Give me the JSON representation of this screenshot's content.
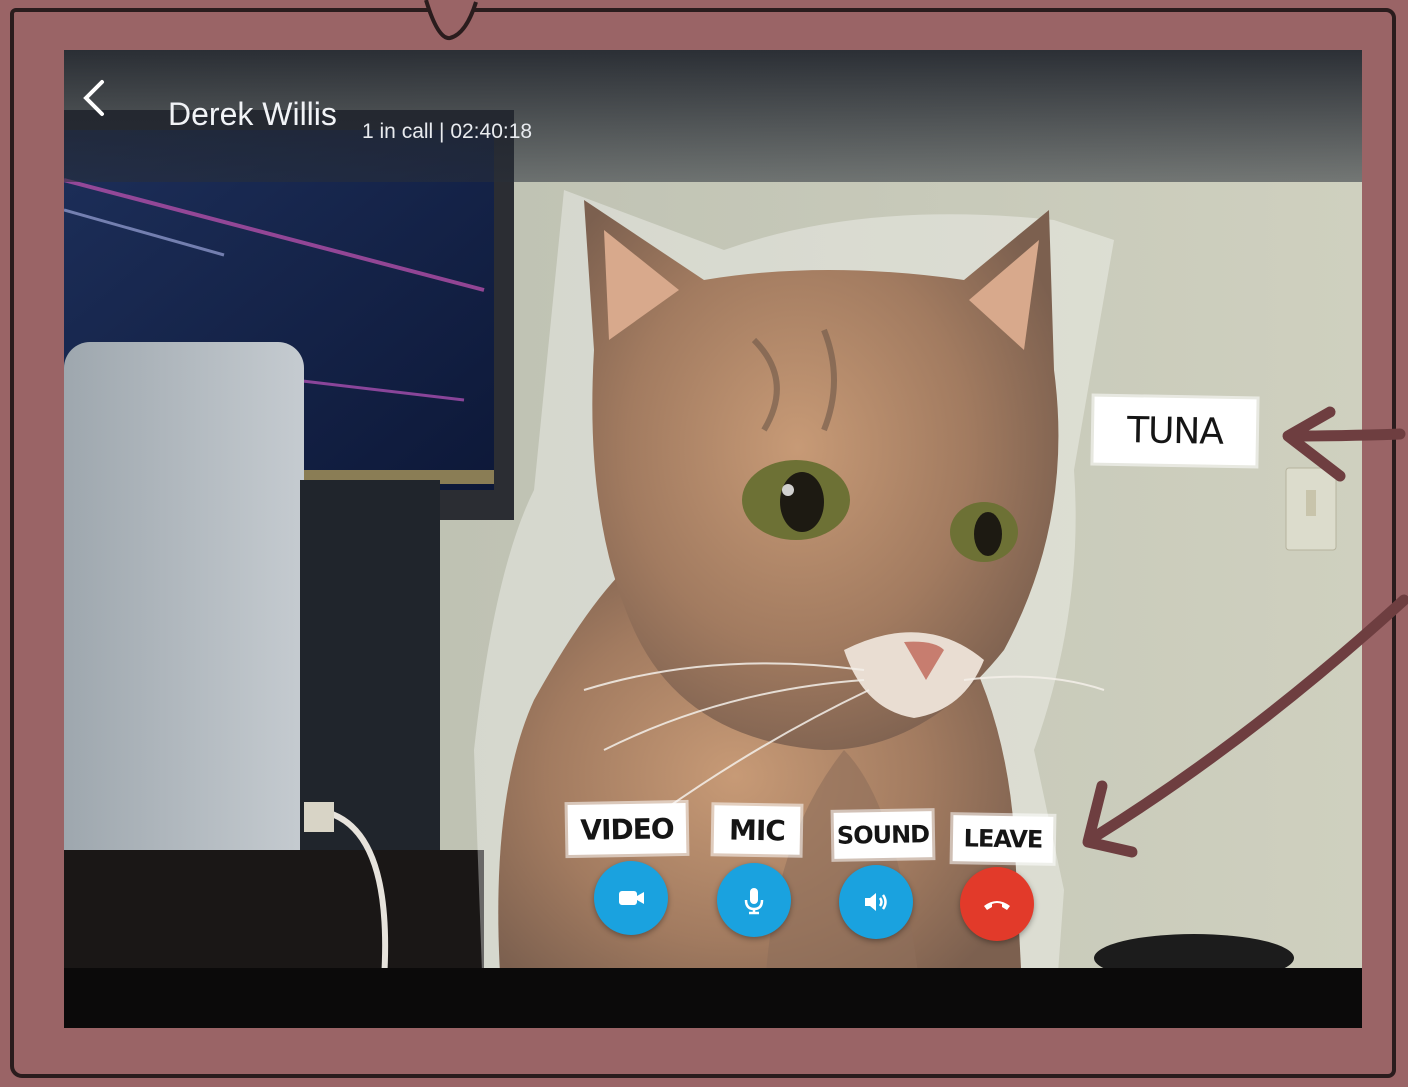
{
  "call": {
    "contact_name": "Derek Willis",
    "status": "1 in call | 02:40:18"
  },
  "annotations": {
    "pet_name": "TUNA",
    "video_label": "VIDEO",
    "mic_label": "MIC",
    "sound_label": "SOUND",
    "leave_label": "LEAVE"
  },
  "controls": [
    {
      "name": "video",
      "icon": "video-camera-icon",
      "color": "#1aa2df"
    },
    {
      "name": "mic",
      "icon": "microphone-icon",
      "color": "#1aa2df"
    },
    {
      "name": "sound",
      "icon": "speaker-icon",
      "color": "#1aa2df"
    },
    {
      "name": "leave",
      "icon": "hang-up-icon",
      "color": "#e23a2a"
    }
  ],
  "colors": {
    "frame": "#9a6466",
    "ink": "#6e3e40",
    "control_blue": "#1aa2df",
    "control_red": "#e23a2a"
  }
}
